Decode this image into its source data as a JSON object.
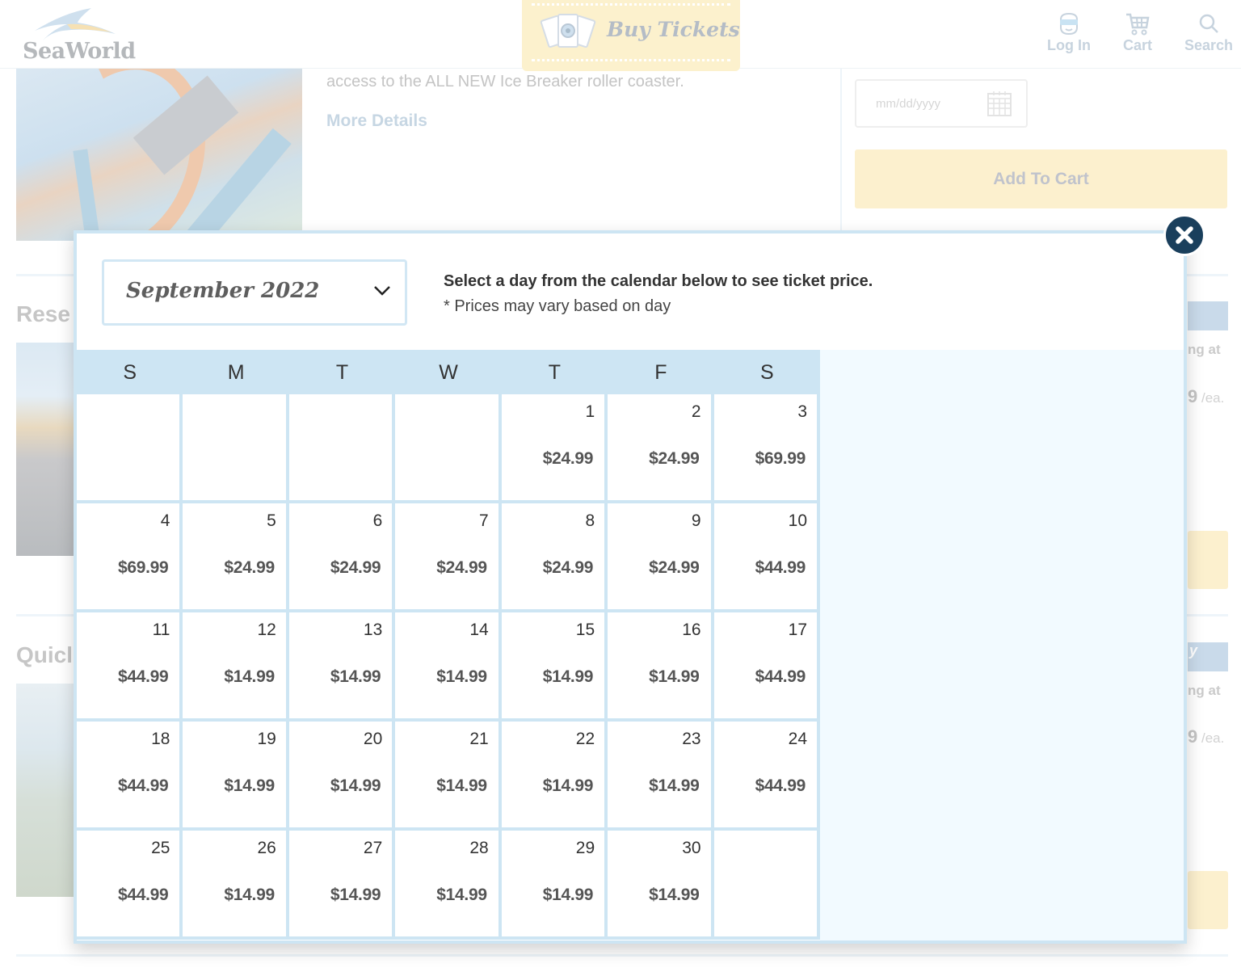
{
  "header": {
    "logo_text": "SeaWorld",
    "buy_tickets_label": "Buy Tickets",
    "nav": [
      {
        "label": "Log In",
        "icon": "user-icon"
      },
      {
        "label": "Cart",
        "icon": "cart-icon"
      },
      {
        "label": "Search",
        "icon": "search-icon"
      }
    ]
  },
  "background": {
    "description_fragment": "access to the ALL NEW Ice Breaker roller coaster.",
    "more_details_label": "More Details",
    "date_placeholder": "mm/dd/yyyy",
    "add_to_cart_label": "Add To Cart",
    "section_titles": [
      "Rese",
      "Quicl"
    ],
    "side_text": [
      "ng at",
      "ng at"
    ],
    "side_prices": [
      {
        "digit": "9",
        "unit": "/ea."
      },
      {
        "digit": "9",
        "unit": "/ea."
      }
    ],
    "side_badge_fragment": "y"
  },
  "modal": {
    "month_selected": "September 2022",
    "instruction": "Select a day from the calendar below to see ticket price.",
    "note": "* Prices may vary based on day",
    "weekdays": [
      "S",
      "M",
      "T",
      "W",
      "T",
      "F",
      "S"
    ],
    "days": [
      {
        "day": "",
        "price": ""
      },
      {
        "day": "",
        "price": ""
      },
      {
        "day": "",
        "price": ""
      },
      {
        "day": "",
        "price": ""
      },
      {
        "day": "1",
        "price": "$24.99"
      },
      {
        "day": "2",
        "price": "$24.99"
      },
      {
        "day": "3",
        "price": "$69.99"
      },
      {
        "day": "4",
        "price": "$69.99"
      },
      {
        "day": "5",
        "price": "$24.99"
      },
      {
        "day": "6",
        "price": "$24.99"
      },
      {
        "day": "7",
        "price": "$24.99"
      },
      {
        "day": "8",
        "price": "$24.99"
      },
      {
        "day": "9",
        "price": "$24.99"
      },
      {
        "day": "10",
        "price": "$44.99"
      },
      {
        "day": "11",
        "price": "$44.99"
      },
      {
        "day": "12",
        "price": "$14.99"
      },
      {
        "day": "13",
        "price": "$14.99"
      },
      {
        "day": "14",
        "price": "$14.99"
      },
      {
        "day": "15",
        "price": "$14.99"
      },
      {
        "day": "16",
        "price": "$14.99"
      },
      {
        "day": "17",
        "price": "$44.99"
      },
      {
        "day": "18",
        "price": "$44.99"
      },
      {
        "day": "19",
        "price": "$14.99"
      },
      {
        "day": "20",
        "price": "$14.99"
      },
      {
        "day": "21",
        "price": "$14.99"
      },
      {
        "day": "22",
        "price": "$14.99"
      },
      {
        "day": "23",
        "price": "$14.99"
      },
      {
        "day": "24",
        "price": "$44.99"
      },
      {
        "day": "25",
        "price": "$44.99"
      },
      {
        "day": "26",
        "price": "$14.99"
      },
      {
        "day": "27",
        "price": "$14.99"
      },
      {
        "day": "28",
        "price": "$14.99"
      },
      {
        "day": "29",
        "price": "$14.99"
      },
      {
        "day": "30",
        "price": "$14.99"
      },
      {
        "day": "",
        "price": ""
      }
    ]
  },
  "colors": {
    "close_button": "#1a3f5c",
    "calendar_border": "#cde5f3",
    "side_panel": "#f2faff",
    "add_to_cart_bg": "#fcf0ce"
  }
}
